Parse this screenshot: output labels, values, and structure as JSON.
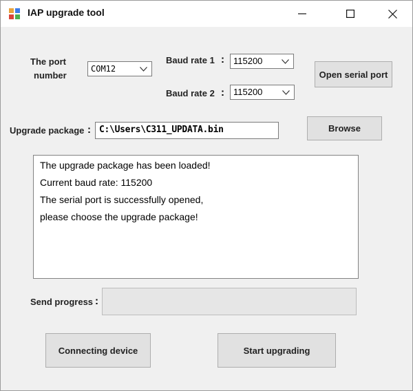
{
  "window": {
    "title": "IAP upgrade tool",
    "minimize_icon": "minimize-icon",
    "maximize_icon": "maximize-icon",
    "close_icon": "close-icon",
    "app_icon": "app-icon"
  },
  "port": {
    "label_line1": "The port",
    "label_line2": "number",
    "value": "COM12"
  },
  "baud1": {
    "label": "Baud rate 1",
    "colon": ":",
    "value": "115200"
  },
  "baud2": {
    "label": "Baud rate 2",
    "colon": ":",
    "value": "115200"
  },
  "buttons": {
    "open_serial_port": "Open serial port",
    "browse": "Browse",
    "connecting_device": "Connecting device",
    "start_upgrading": "Start upgrading"
  },
  "package": {
    "label": "Upgrade package",
    "colon": ":",
    "path": "C:\\Users\\C311_UPDATA.bin"
  },
  "log": {
    "lines": [
      "The upgrade package has been loaded!",
      "Current baud rate: 115200",
      "The serial port is successfully opened,",
      "please choose the upgrade package!"
    ]
  },
  "progress": {
    "label": "Send progress",
    "colon": ":",
    "value_percent": 0
  },
  "colors": {
    "window_bg": "#f0f0f0",
    "button_bg": "#e1e1e1",
    "progress_fill": "#06b025"
  }
}
